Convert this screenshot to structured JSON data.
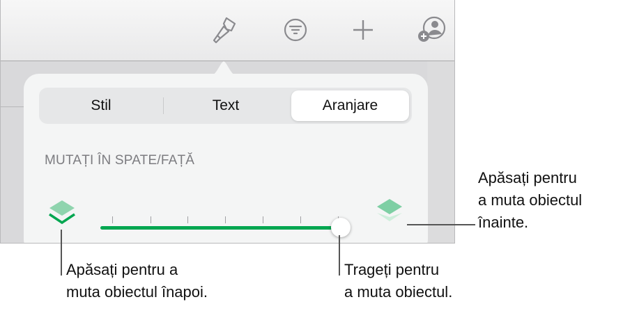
{
  "toolbar": {
    "icons": [
      "paintbrush-icon",
      "filter-icon",
      "plus-icon",
      "add-collaborator-icon"
    ]
  },
  "popover": {
    "tabs": [
      {
        "label": "Stil"
      },
      {
        "label": "Text"
      },
      {
        "label": "Aranjare",
        "active": true
      }
    ],
    "section_header": "MUTAȚI ÎN SPATE/FAȚĂ",
    "slider": {
      "value": 1.0,
      "ticks": 7
    },
    "colors": {
      "accent": "#00a650",
      "layer_light": "#7ecfa4"
    }
  },
  "callouts": {
    "forward": [
      "Apăsați pentru",
      "a muta obiectul",
      "înainte."
    ],
    "backward": [
      "Apăsați pentru a",
      "muta obiectul înapoi."
    ],
    "drag": [
      "Trageți pentru",
      "a muta obiectul."
    ]
  }
}
